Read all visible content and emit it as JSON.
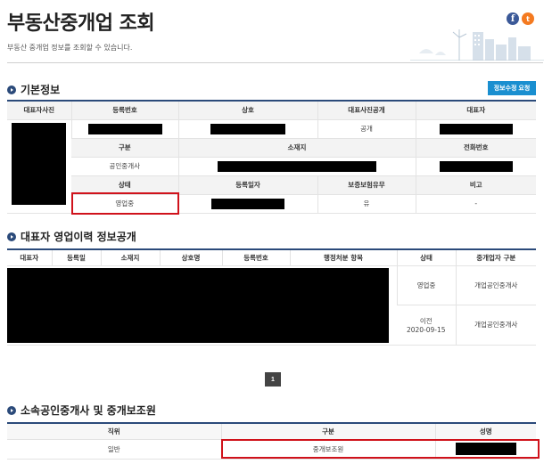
{
  "page": {
    "title": "부동산중개업 조회",
    "description": "부동산 중개업 정보를 조회할 수 있습니다.",
    "social": {
      "facebook_icon": "facebook-icon",
      "twitter_icon": "twitter-icon"
    }
  },
  "basic_info": {
    "section_title": "기본정보",
    "edit_button": "정보수정 요청",
    "headers_row1": [
      "대표자사진",
      "등록번호",
      "상호",
      "대표사진공개",
      "대표자"
    ],
    "photo_public": "공개",
    "headers_row2": [
      "구분",
      "소재지",
      "전화번호"
    ],
    "category": "공인중개사",
    "headers_row3": [
      "상태",
      "등록일자",
      "보증보험유무",
      "비고"
    ],
    "status": "영업중",
    "insurance": "유",
    "note": "-"
  },
  "history": {
    "section_title": "대표자 영업이력 정보공개",
    "headers": [
      "대표자",
      "등록일",
      "소재지",
      "상호명",
      "등록번호",
      "행정처분 항목",
      "상태",
      "중개업자 구분"
    ],
    "rows": [
      {
        "status": "영업중",
        "status2": "",
        "type": "개업공인중개사"
      },
      {
        "status": "이전",
        "status2": "2020-09-15",
        "type": "개업공인중개사"
      }
    ]
  },
  "pagination": {
    "current": "1"
  },
  "members": {
    "section_title": "소속공인중개사 및 중개보조원",
    "headers": [
      "직위",
      "구분",
      "성명"
    ],
    "rows": [
      {
        "position": "일반",
        "category": "중개보조원"
      }
    ]
  },
  "colors": {
    "accent": "#1a8fd0",
    "navy": "#2b4a7a",
    "highlight": "#d0121b"
  }
}
